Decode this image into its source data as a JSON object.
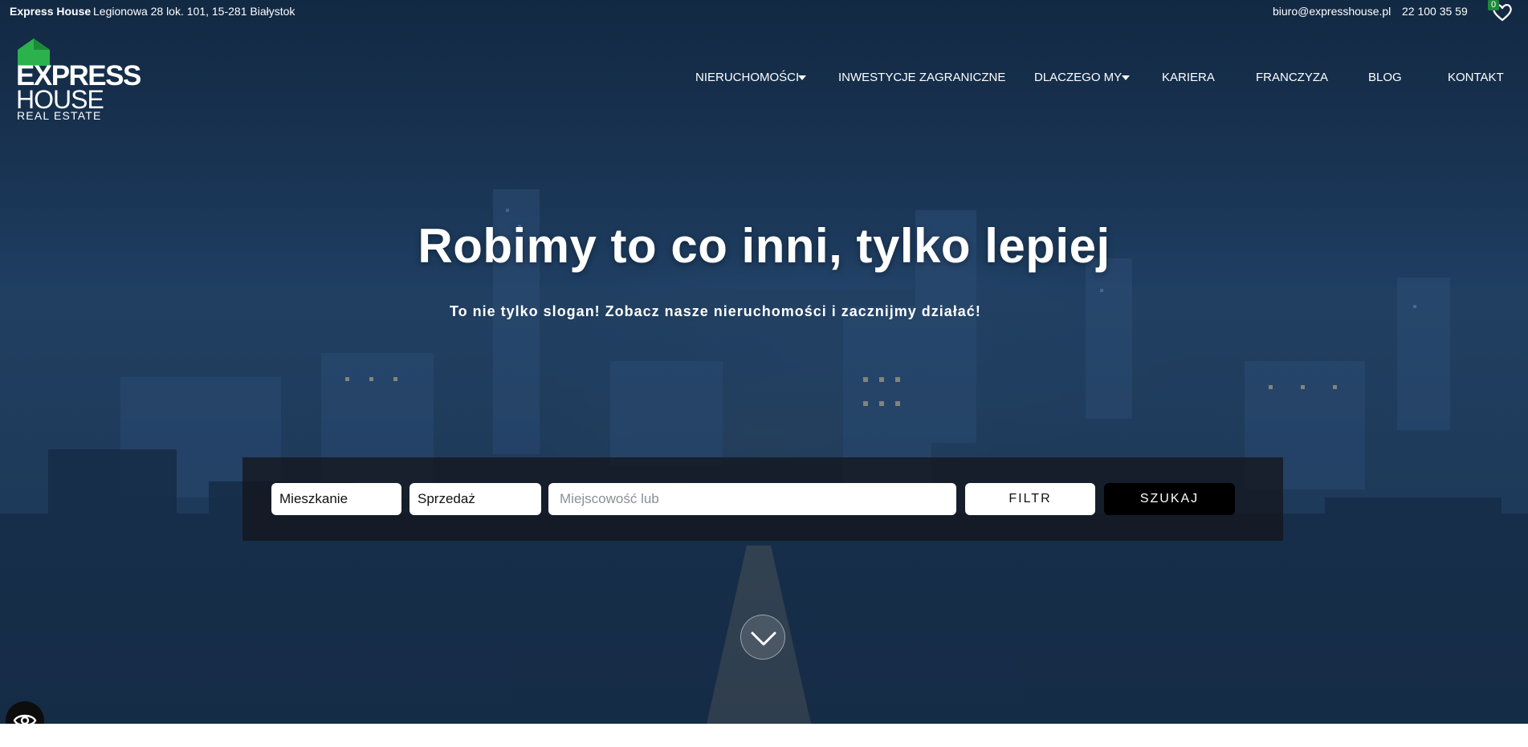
{
  "topbar": {
    "brand": "Express House",
    "address": "Legionowa 28 lok. 101,  15-281 Białystok",
    "email": "biuro@expresshouse.pl",
    "phone": "22 100 35 59",
    "favorites_count": "0",
    "favorites_icon": "heart-icon"
  },
  "logo": {
    "line1": "EXPRESS",
    "line2": "HOUSE",
    "line3": "REAL ESTATE",
    "color": "#2bb24c"
  },
  "nav": {
    "items": [
      {
        "label": "NIERUCHOMOŚCI",
        "has_dropdown": true
      },
      {
        "label": "INWESTYCJE ZAGRANICZNE",
        "has_dropdown": false
      },
      {
        "label": "DLACZEGO MY",
        "has_dropdown": true
      },
      {
        "label": "KARIERA",
        "has_dropdown": false
      },
      {
        "label": "FRANCZYZA",
        "has_dropdown": false
      },
      {
        "label": "BLOG",
        "has_dropdown": false
      },
      {
        "label": "KONTAKT",
        "has_dropdown": false
      }
    ]
  },
  "hero": {
    "headline": "Robimy to co inni, tylko lepiej",
    "subline": "To nie tylko slogan! Zobacz nasze nieruchomości i zacznijmy działać!"
  },
  "search": {
    "property_type": "Mieszkanie",
    "transaction_type": "Sprzedaż",
    "location_placeholder": "Miejscowość lub",
    "filter_label": "FILTR",
    "search_label": "SZUKAJ"
  },
  "icons": {
    "scroll": "chevron-down-icon",
    "accessibility": "accessibility-icon"
  }
}
